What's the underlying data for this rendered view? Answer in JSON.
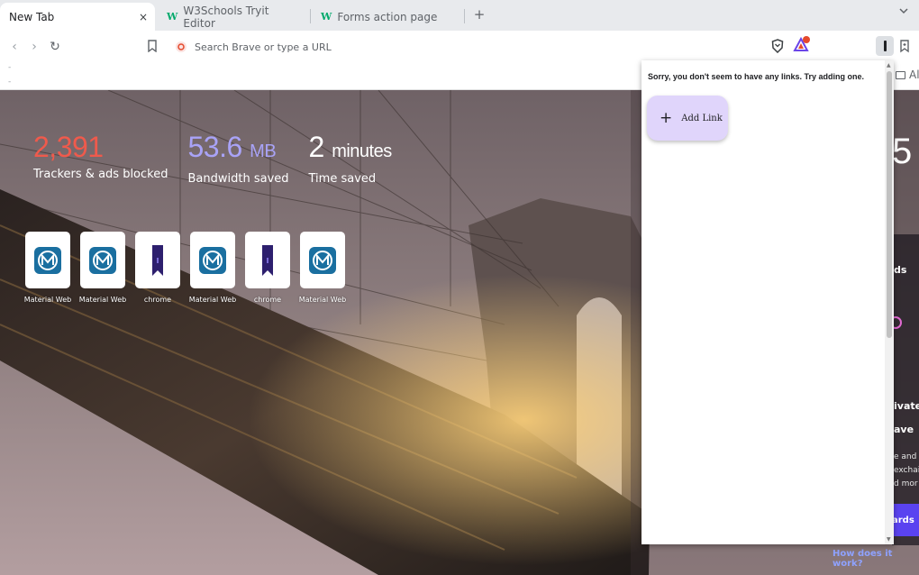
{
  "tabs": [
    {
      "label": "New Tab",
      "active": true,
      "close": "×"
    },
    {
      "label": "W3Schools Tryit Editor",
      "favicon": "W"
    },
    {
      "label": "Forms action page",
      "favicon": "W"
    }
  ],
  "tabstrip": {
    "new_tab": "+",
    "tab_list": "⌄"
  },
  "toolbar": {
    "back": "‹",
    "forward": "›",
    "reload": "↻",
    "omnibox_placeholder": "Search Brave or type a URL"
  },
  "bookmarks_bar": {
    "dot1": "-",
    "dot2": "-",
    "all_label": "All"
  },
  "stats": {
    "trackers": {
      "value": "2,391",
      "label": "Trackers & ads blocked"
    },
    "bandwidth": {
      "value": "53.6",
      "unit": "MB",
      "label": "Bandwidth saved"
    },
    "time": {
      "value": "2",
      "unit": "minutes",
      "label": "Time saved"
    }
  },
  "top_sites": [
    {
      "label": "Material Web",
      "icon": "material-web-icon"
    },
    {
      "label": "Material Web",
      "icon": "material-web-icon"
    },
    {
      "label": "chrome",
      "icon": "bookmark-ribbon-icon"
    },
    {
      "label": "Material Web",
      "icon": "material-web-icon"
    },
    {
      "label": "chrome",
      "icon": "bookmark-ribbon-icon"
    },
    {
      "label": "Material Web",
      "icon": "material-web-icon"
    }
  ],
  "peek": {
    "clock": "5",
    "t1": "ds",
    "t2": "ivate",
    "t3": "ave",
    "s1": "e and u",
    "s2": "exchai",
    "s3": "d mor",
    "btn": "ards",
    "how": "How does it work?"
  },
  "popup": {
    "message": "Sorry, you don't seem to have any links. Try adding one.",
    "add_plus": "+",
    "add_label": "Add Link"
  },
  "colors": {
    "trackers": "#ef5a4c",
    "bandwidth": "#a9a3f7",
    "material_blue": "#1a6fa0",
    "chrome_ribbon": "#2d1f6e",
    "add_link_bg": "#e0d5fb"
  }
}
